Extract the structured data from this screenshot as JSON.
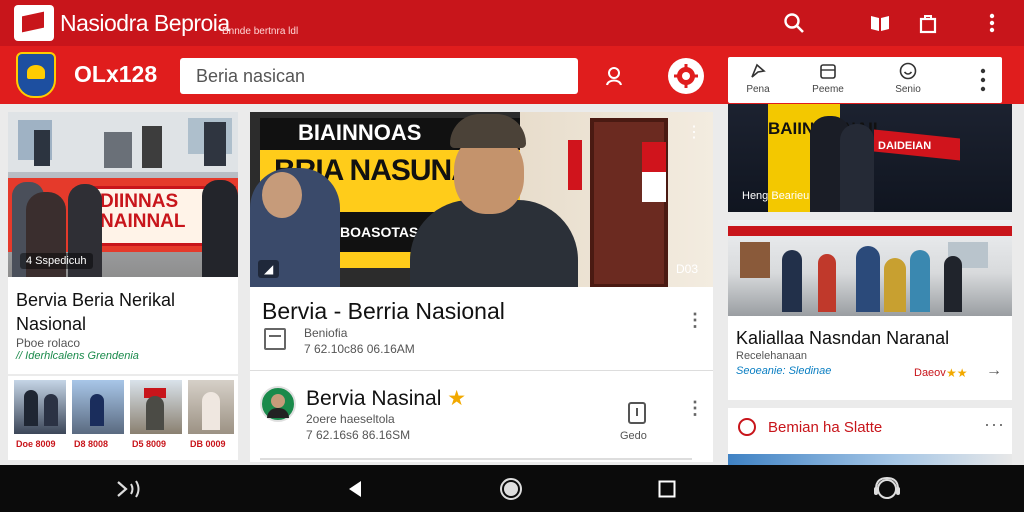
{
  "header": {
    "title": "Nasiodra Beproia",
    "subtitle": "Bnnde bertnra ldl",
    "icons": [
      "search-icon",
      "book-icon",
      "bag-icon",
      "more-vert-icon"
    ]
  },
  "subheader": {
    "brand": "OLx128",
    "search": {
      "value": "",
      "placeholder": "Beria nasican"
    },
    "icons": [
      "user-search-icon",
      "settings-icon"
    ]
  },
  "right_tabs": [
    {
      "label": "Pena",
      "icon": "navigation-icon"
    },
    {
      "label": "Peeme",
      "icon": "calendar-icon"
    },
    {
      "label": "Senio",
      "icon": "smile-icon"
    }
  ],
  "left_column": {
    "banner_text": "DIINNAS NAINNAL",
    "photo_caption": "4 Sspedicuh",
    "headline": "Bervia Beria Nerikal Nasional",
    "meta": "Pboe rolaco",
    "tag": "// Iderhlcalens Grendenia",
    "thumbs": [
      {
        "label": "Doe 8009"
      },
      {
        "label": "D8 8008"
      },
      {
        "label": "D5 8009"
      },
      {
        "label": "DB 0009"
      }
    ]
  },
  "center": {
    "banner_line1": "BIAINNOAS",
    "banner_line2": "BRIA NASUNAL",
    "banner_line3": "BOASOTAS SULER",
    "photo_counter": "D03",
    "article1": {
      "title": "Bervia - Berria Nasional",
      "meta": "Beniofia",
      "date": "7 62.10c86 06.16AM"
    },
    "article2": {
      "title": "Bervia Nasinal",
      "star": "★",
      "meta": "2oere haeseltola",
      "date": "7 62.16s6 86.16SM",
      "action_label": "Gedo"
    }
  },
  "right_column": {
    "banner": "BAIINAR NAII",
    "flag_text": "DAIDEIAN",
    "photo_caption": "Heng Bearieu",
    "headline": "Kaliallaa Nasndan Naranal",
    "meta": "Recelehanaan",
    "tag": "Seoeanie: Sledinae",
    "rating_label": "Daeov",
    "stars": "★★",
    "footer_title": "Bemian ha Slatte"
  },
  "colors": {
    "primary": "#c8151b",
    "band": "#e01d1d",
    "accent_green": "#1a8a4b"
  },
  "navbar_icons": [
    "voice-icon",
    "back-icon",
    "home-icon",
    "recents-icon",
    "assistant-icon"
  ]
}
